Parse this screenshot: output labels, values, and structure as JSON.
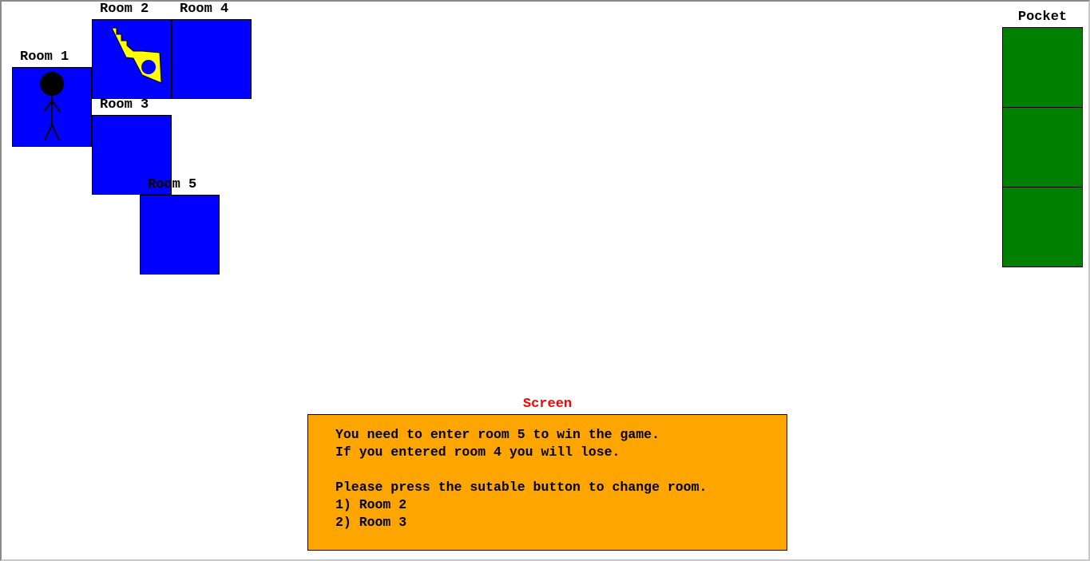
{
  "colors": {
    "room": "#0000ff",
    "pocket": "#008000",
    "screen_bg": "#ffa500",
    "screen_title": "#ff0000",
    "key": "#ffff00"
  },
  "rooms": {
    "room1": {
      "label": "Room 1",
      "content": "player-icon"
    },
    "room2": {
      "label": "Room 2",
      "content": "key-icon"
    },
    "room3": {
      "label": "Room 3"
    },
    "room4": {
      "label": "Room 4"
    },
    "room5": {
      "label": "Room 5"
    }
  },
  "pocket": {
    "title": "Pocket",
    "slots": [
      "",
      "",
      ""
    ]
  },
  "screen": {
    "title": "Screen",
    "lines": [
      "You need to enter room 5 to win the game.",
      "If you entered room 4 you will lose.",
      "",
      "Please press the sutable button to change room.",
      "1) Room 2",
      "2) Room 3"
    ]
  }
}
